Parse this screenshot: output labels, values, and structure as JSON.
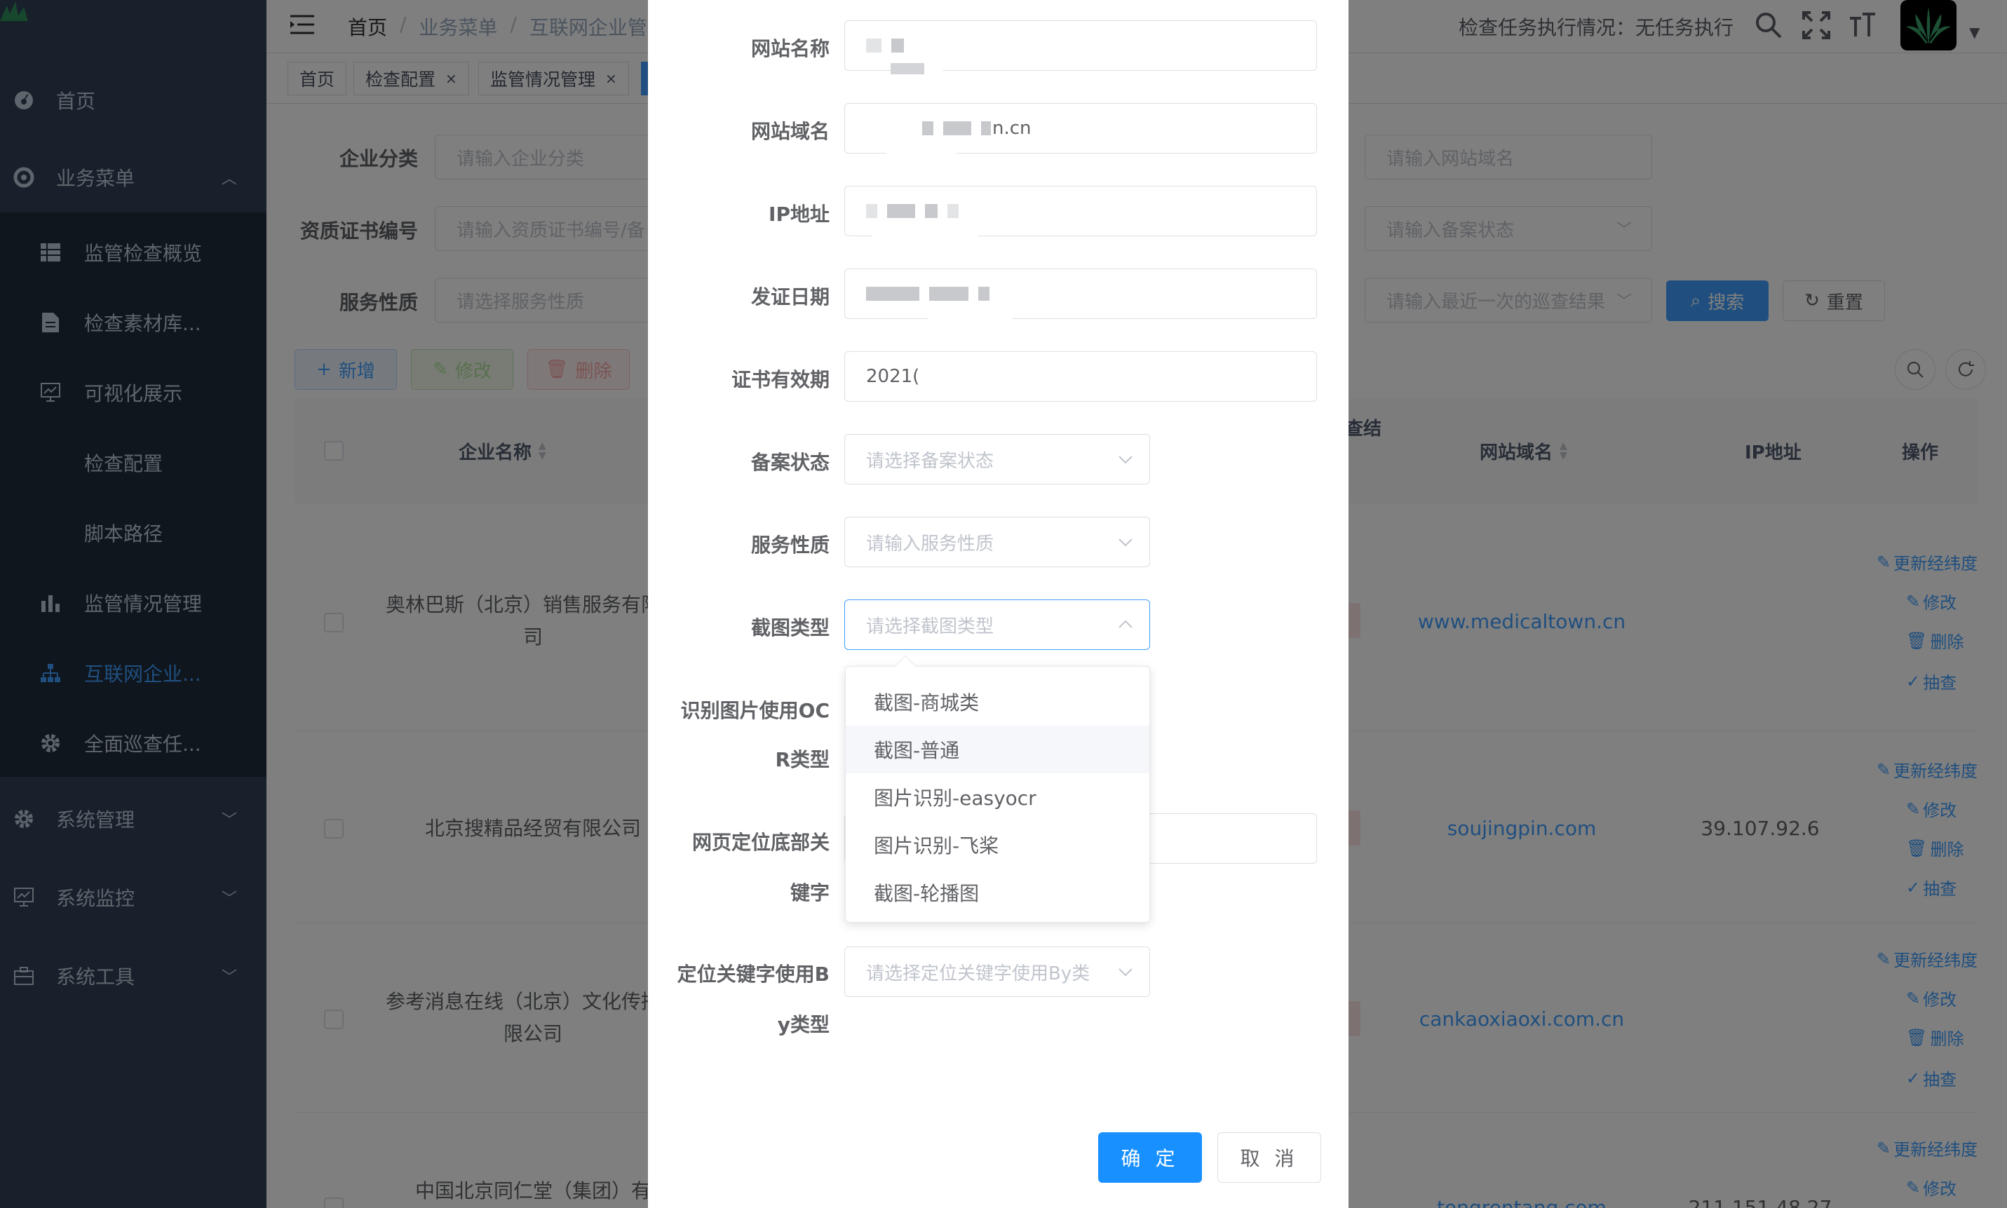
{
  "sidebar": {
    "items": [
      {
        "label": "首页",
        "icon": "dashboard-icon"
      },
      {
        "label": "业务菜单",
        "icon": "lifebuoy-icon"
      },
      {
        "label": "系统管理",
        "icon": "gear-icon"
      },
      {
        "label": "系统监控",
        "icon": "monitor-icon"
      },
      {
        "label": "系统工具",
        "icon": "toolbox-icon"
      }
    ],
    "sub_items": [
      {
        "label": "监管检查概览",
        "icon": "table-icon"
      },
      {
        "label": "检查素材库...",
        "icon": "document-icon"
      },
      {
        "label": "可视化展示",
        "icon": "chart-screen-icon"
      },
      {
        "label": "检查配置",
        "icon": ""
      },
      {
        "label": "脚本路径",
        "icon": ""
      },
      {
        "label": "监管情况管理",
        "icon": "bar-chart-icon"
      },
      {
        "label": "互联网企业...",
        "icon": "tree-icon"
      },
      {
        "label": "全面巡查任...",
        "icon": "gear-icon"
      }
    ]
  },
  "navbar": {
    "breadcrumb": [
      "首页",
      "业务菜单",
      "互联网企业管"
    ],
    "task_status": "检查任务执行情况：无任务执行"
  },
  "tags": [
    {
      "label": "首页"
    },
    {
      "label": "检查配置"
    },
    {
      "label": "监管情况管理"
    }
  ],
  "search": {
    "labels": {
      "category": "企业分类",
      "cert_no": "资质证书编号",
      "service": "服务性质"
    },
    "placeholders": {
      "category": "请输入企业分类",
      "cert_no": "请输入资质证书编号/备",
      "service": "请选择服务性质",
      "domain": "请输入网站域名",
      "record": "请输入备案状态",
      "last_result": "请输入最近一次的巡查结果"
    },
    "search_btn": "搜索",
    "reset_btn": "重置"
  },
  "toolbar": {
    "add": "新增",
    "edit": "修改",
    "delete": "删除"
  },
  "table": {
    "headers": {
      "name": "企业名称",
      "partial": "查结",
      "domain": "网站域名",
      "ip": "IP地址",
      "ops": "操作"
    },
    "rows": [
      {
        "name": "奥林巴斯（北京）销售服务有限公司",
        "domain": "www.medicaltown.cn",
        "ip": ""
      },
      {
        "name": "北京搜精品经贸有限公司",
        "domain": "soujingpin.com",
        "ip": "39.107.92.6"
      },
      {
        "name": "参考消息在线（北京）文化传播有限公司",
        "domain": "cankaoxiaoxi.com.cn",
        "ip": ""
      },
      {
        "name": "中国北京同仁堂（集团）有",
        "domain": "tongrentang.com",
        "ip": "211.151.48.27"
      }
    ],
    "ops": {
      "update_geo": "更新经纬度",
      "edit": "修改",
      "delete": "删除",
      "sample": "抽查"
    }
  },
  "dialog": {
    "labels": {
      "site_name": "网站名称",
      "site_domain": "网站域名",
      "ip": "IP地址",
      "issue_date": "发证日期",
      "cert_valid": "证书有效期",
      "record_status": "备案状态",
      "service_nature": "服务性质",
      "screenshot_type": "截图类型",
      "ocr_type_1": "识别图片使用OC",
      "ocr_type_2": "R类型",
      "locate_kw_1": "网页定位底部关",
      "locate_kw_2": "键字",
      "by_type_1": "定位关键字使用B",
      "by_type_2": "y类型"
    },
    "values": {
      "site_domain_suffix": "n.cn",
      "cert_valid": "2021("
    },
    "placeholders": {
      "record_status": "请选择备案状态",
      "service_nature": "请输入服务性质",
      "screenshot_type": "请选择截图类型",
      "by_type": "请选择定位关键字使用By类"
    },
    "dropdown_options": [
      "截图-商城类",
      "截图-普通",
      "图片识别-easyocr",
      "图片识别-飞桨",
      "截图-轮播图"
    ],
    "confirm": "确 定",
    "cancel": "取 消"
  }
}
